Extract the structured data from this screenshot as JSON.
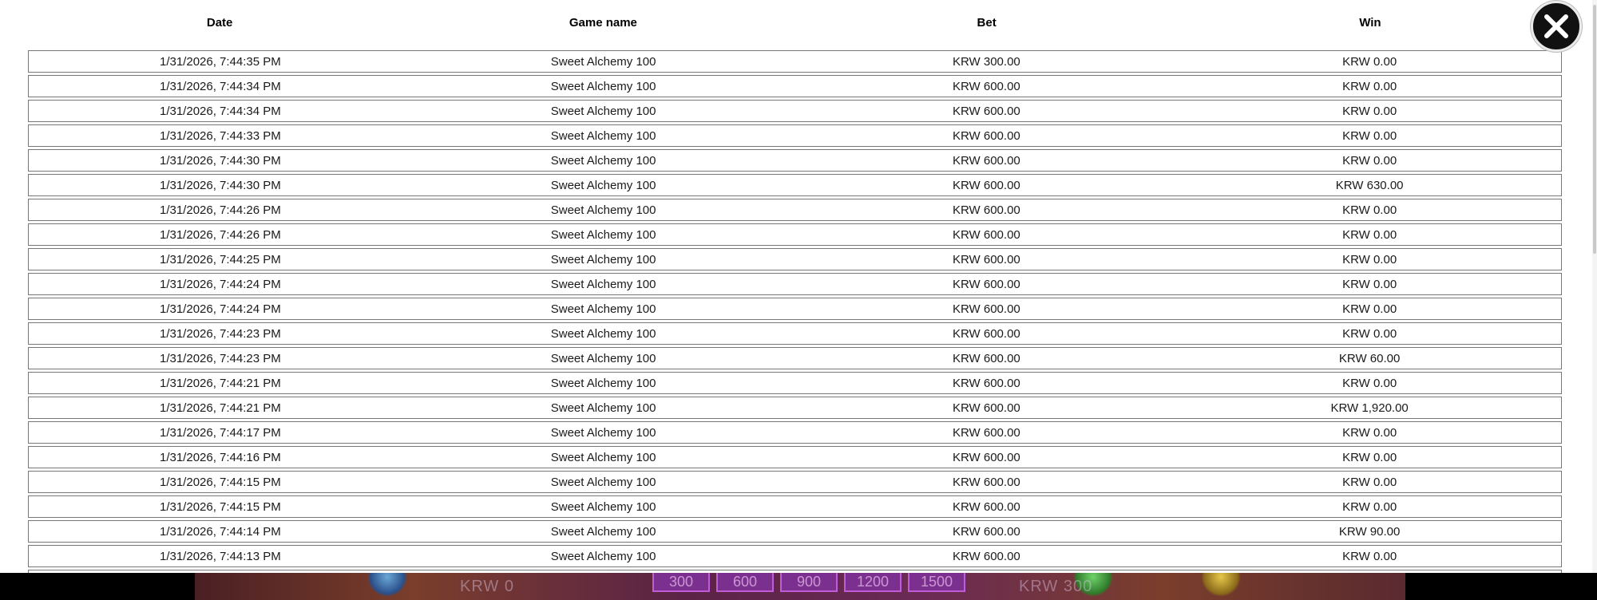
{
  "table": {
    "headers": {
      "date": "Date",
      "game": "Game name",
      "bet": "Bet",
      "win": "Win"
    },
    "rows": [
      {
        "date": "1/31/2026, 7:44:35 PM",
        "game": "Sweet Alchemy 100",
        "bet": "KRW 300.00",
        "win": "KRW 0.00"
      },
      {
        "date": "1/31/2026, 7:44:34 PM",
        "game": "Sweet Alchemy 100",
        "bet": "KRW 600.00",
        "win": "KRW 0.00"
      },
      {
        "date": "1/31/2026, 7:44:34 PM",
        "game": "Sweet Alchemy 100",
        "bet": "KRW 600.00",
        "win": "KRW 0.00"
      },
      {
        "date": "1/31/2026, 7:44:33 PM",
        "game": "Sweet Alchemy 100",
        "bet": "KRW 600.00",
        "win": "KRW 0.00"
      },
      {
        "date": "1/31/2026, 7:44:30 PM",
        "game": "Sweet Alchemy 100",
        "bet": "KRW 600.00",
        "win": "KRW 0.00"
      },
      {
        "date": "1/31/2026, 7:44:30 PM",
        "game": "Sweet Alchemy 100",
        "bet": "KRW 600.00",
        "win": "KRW 630.00"
      },
      {
        "date": "1/31/2026, 7:44:26 PM",
        "game": "Sweet Alchemy 100",
        "bet": "KRW 600.00",
        "win": "KRW 0.00"
      },
      {
        "date": "1/31/2026, 7:44:26 PM",
        "game": "Sweet Alchemy 100",
        "bet": "KRW 600.00",
        "win": "KRW 0.00"
      },
      {
        "date": "1/31/2026, 7:44:25 PM",
        "game": "Sweet Alchemy 100",
        "bet": "KRW 600.00",
        "win": "KRW 0.00"
      },
      {
        "date": "1/31/2026, 7:44:24 PM",
        "game": "Sweet Alchemy 100",
        "bet": "KRW 600.00",
        "win": "KRW 0.00"
      },
      {
        "date": "1/31/2026, 7:44:24 PM",
        "game": "Sweet Alchemy 100",
        "bet": "KRW 600.00",
        "win": "KRW 0.00"
      },
      {
        "date": "1/31/2026, 7:44:23 PM",
        "game": "Sweet Alchemy 100",
        "bet": "KRW 600.00",
        "win": "KRW 0.00"
      },
      {
        "date": "1/31/2026, 7:44:23 PM",
        "game": "Sweet Alchemy 100",
        "bet": "KRW 600.00",
        "win": "KRW 60.00"
      },
      {
        "date": "1/31/2026, 7:44:21 PM",
        "game": "Sweet Alchemy 100",
        "bet": "KRW 600.00",
        "win": "KRW 0.00"
      },
      {
        "date": "1/31/2026, 7:44:21 PM",
        "game": "Sweet Alchemy 100",
        "bet": "KRW 600.00",
        "win": "KRW 1,920.00"
      },
      {
        "date": "1/31/2026, 7:44:17 PM",
        "game": "Sweet Alchemy 100",
        "bet": "KRW 600.00",
        "win": "KRW 0.00"
      },
      {
        "date": "1/31/2026, 7:44:16 PM",
        "game": "Sweet Alchemy 100",
        "bet": "KRW 600.00",
        "win": "KRW 0.00"
      },
      {
        "date": "1/31/2026, 7:44:15 PM",
        "game": "Sweet Alchemy 100",
        "bet": "KRW 600.00",
        "win": "KRW 0.00"
      },
      {
        "date": "1/31/2026, 7:44:15 PM",
        "game": "Sweet Alchemy 100",
        "bet": "KRW 600.00",
        "win": "KRW 0.00"
      },
      {
        "date": "1/31/2026, 7:44:14 PM",
        "game": "Sweet Alchemy 100",
        "bet": "KRW 600.00",
        "win": "KRW 90.00"
      },
      {
        "date": "1/31/2026, 7:44:13 PM",
        "game": "Sweet Alchemy 100",
        "bet": "KRW 600.00",
        "win": "KRW 0.00"
      },
      {
        "date": "",
        "game": "",
        "bet": "",
        "win": ""
      }
    ]
  },
  "close_icon": "close-x-icon",
  "game_bar": {
    "left_amount": "KRW 0",
    "bet_options": [
      "300",
      "600",
      "900",
      "1200",
      "1500"
    ],
    "right_amount": "KRW 300"
  },
  "colors": {
    "panel_bg": "#ffffff",
    "row_border": "#777777",
    "close_bg": "#111111"
  }
}
